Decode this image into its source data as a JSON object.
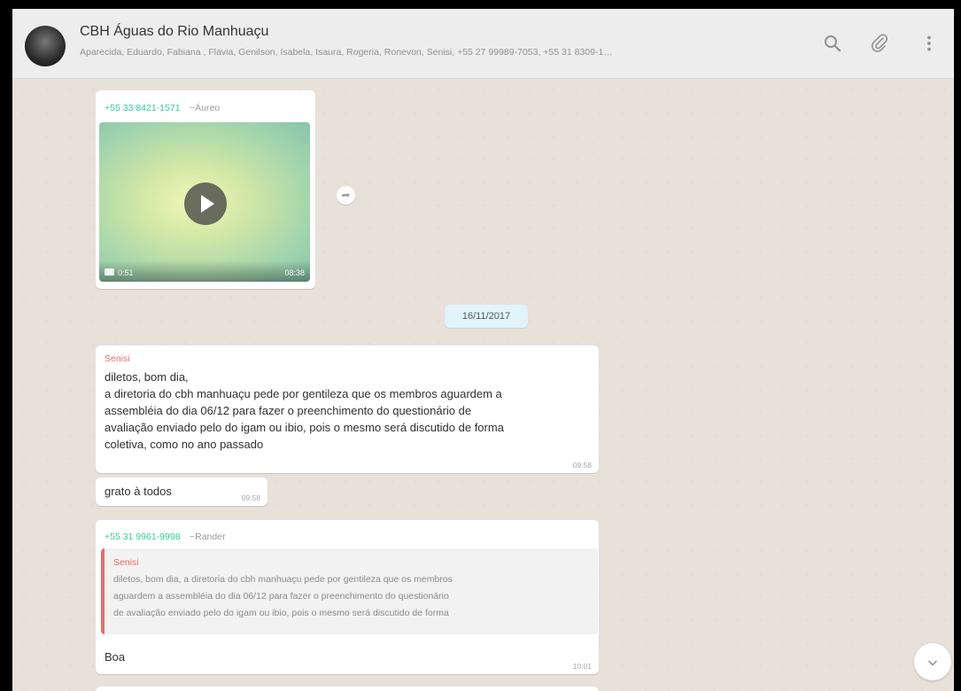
{
  "header": {
    "title": "CBH Águas do Rio Manhuaçu",
    "members": "Aparecida, Eduardo, Fabiana , Flavia, Genilson, Isabela, Isaura, Rogeria, Ronevon, Senisi, +55 27 99989-7053, +55 31 8309-1…"
  },
  "icons": {
    "search": "search-icon",
    "attach": "paperclip-icon",
    "menu": "more-vert-icon",
    "forward": "forward-icon",
    "scroll": "chevron-down-icon"
  },
  "messages": [
    {
      "sender_number": "+55 33 8421-1571",
      "sender_name": "~Áureo",
      "video_duration": "0:51",
      "time": "08:38"
    },
    {
      "date_divider": "16/11/2017"
    },
    {
      "sender": "Senisi",
      "lines": [
        "diletos, bom dia,",
        "a diretoria do cbh manhuaçu pede por gentileza que os membros aguardem a",
        "assembléia do dia 06/12 para fazer o preenchimento do questionário de",
        "avaliação enviado pelo do igam ou ibio, pois o mesmo será discutido de forma",
        "coletiva, como no ano passado"
      ],
      "time": "09:58"
    },
    {
      "text": "grato à todos",
      "time": "09:58"
    },
    {
      "sender_number": "+55 31 9961-9998",
      "sender_name": "~Rander",
      "quote_sender": "Senisi",
      "quote_lines": [
        "diletos, bom dia, a diretoria do cbh manhuaçu pede por gentileza que os membros",
        "aguardem a assembléia do dia 06/12 para fazer o preenchimento do questionário",
        "de avaliação enviado pelo do igam ou ibio, pois o mesmo será discutido de forma"
      ],
      "text": "Boa",
      "time": "10:01"
    }
  ],
  "colors": {
    "green_number": "#35cd96",
    "pink_name": "#e96b6b",
    "date_pill": "#e1f3fb"
  }
}
